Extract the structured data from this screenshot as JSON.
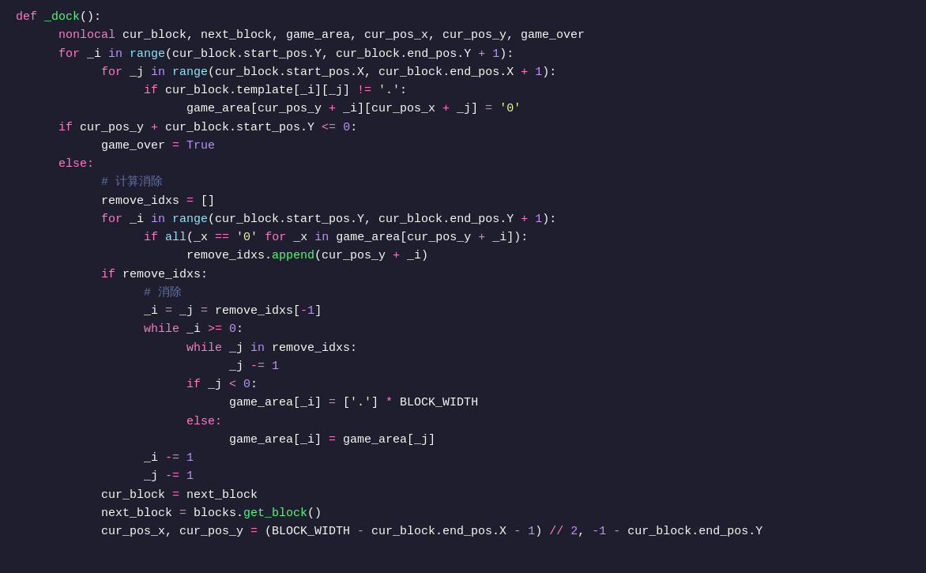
{
  "editor": {
    "background": "#1e1e2e",
    "lines": [
      {
        "indent": 0,
        "content": "def _dock():"
      },
      {
        "indent": 1,
        "content": "nonlocal cur_block, next_block, game_area, cur_pos_x, cur_pos_y, game_over"
      },
      {
        "indent": 1,
        "content": "for _i in range(cur_block.start_pos.Y, cur_block.end_pos.Y + 1):"
      },
      {
        "indent": 2,
        "content": "for _j in range(cur_block.start_pos.X, cur_block.end_pos.X + 1):"
      },
      {
        "indent": 3,
        "content": "if cur_block.template[_i][_j] != '.':"
      },
      {
        "indent": 4,
        "content": "game_area[cur_pos_y + _i][cur_pos_x + _j] = '0'"
      },
      {
        "indent": 1,
        "content": "if cur_pos_y + cur_block.start_pos.Y <= 0:"
      },
      {
        "indent": 2,
        "content": "game_over = True"
      },
      {
        "indent": 1,
        "content": "else:"
      },
      {
        "indent": 2,
        "content": "# 计算消除"
      },
      {
        "indent": 2,
        "content": "remove_idxs = []"
      },
      {
        "indent": 2,
        "content": "for _i in range(cur_block.start_pos.Y, cur_block.end_pos.Y + 1):"
      },
      {
        "indent": 3,
        "content": "if all(_x == '0' for _x in game_area[cur_pos_y + _i]):"
      },
      {
        "indent": 4,
        "content": "remove_idxs.append(cur_pos_y + _i)"
      },
      {
        "indent": 2,
        "content": "if remove_idxs:"
      },
      {
        "indent": 3,
        "content": "# 消除"
      },
      {
        "indent": 3,
        "content": "_i = _j = remove_idxs[-1]"
      },
      {
        "indent": 3,
        "content": "while _i >= 0:"
      },
      {
        "indent": 4,
        "content": "while _j in remove_idxs:"
      },
      {
        "indent": 5,
        "content": "_j -= 1"
      },
      {
        "indent": 4,
        "content": "if _j < 0:"
      },
      {
        "indent": 5,
        "content": "game_area[_i] = ['.'] * BLOCK_WIDTH"
      },
      {
        "indent": 4,
        "content": "else:"
      },
      {
        "indent": 5,
        "content": "game_area[_i] = game_area[_j]"
      },
      {
        "indent": 3,
        "content": "_i -= 1"
      },
      {
        "indent": 3,
        "content": "_j -= 1"
      },
      {
        "indent": 2,
        "content": "cur_block = next_block"
      },
      {
        "indent": 2,
        "content": "next_block = blocks.get_block()"
      },
      {
        "indent": 2,
        "content": "cur_pos_x, cur_pos_y = (BLOCK_WIDTH - cur_block.end_pos.X - 1) // 2, -1 - cur_block.end_pos.Y"
      }
    ]
  }
}
